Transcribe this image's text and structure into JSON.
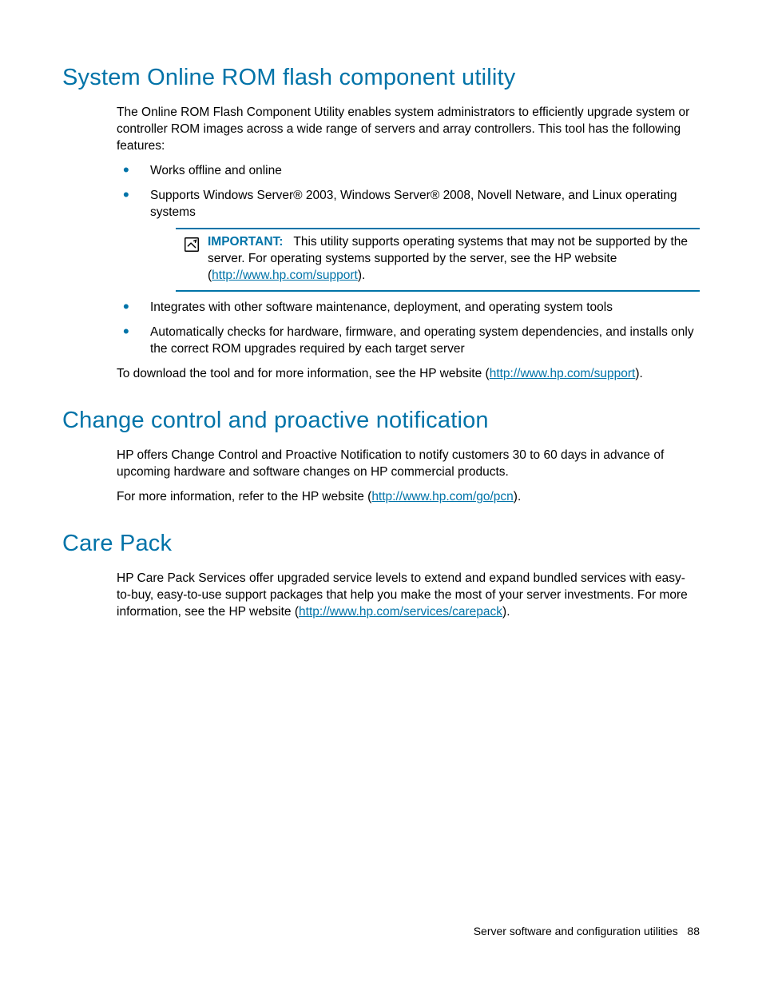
{
  "section1": {
    "heading": "System Online ROM flash component utility",
    "intro": "The Online ROM Flash Component Utility enables system administrators to efficiently upgrade system or controller ROM images across a wide range of servers and array controllers. This tool has the following features:",
    "bullets_pre": [
      "Works offline and online",
      "Supports Windows Server® 2003, Windows Server® 2008, Novell Netware, and Linux operating systems"
    ],
    "callout": {
      "label": "IMPORTANT:",
      "text_before": "This utility supports operating systems that may not be supported by the server. For operating systems supported by the server, see the HP website (",
      "link": "http://www.hp.com/support",
      "text_after": ")."
    },
    "bullets_post": [
      "Integrates with other software maintenance, deployment, and operating system tools",
      "Automatically checks for hardware, firmware, and operating system dependencies, and installs only the correct ROM upgrades required by each target server"
    ],
    "outro_before": "To download the tool and for more information, see the HP website (",
    "outro_link": "http://www.hp.com/support",
    "outro_after": ")."
  },
  "section2": {
    "heading": "Change control and proactive notification",
    "p1": "HP offers Change Control and Proactive Notification to notify customers 30 to 60 days in advance of upcoming hardware and software changes on HP commercial products.",
    "p2_before": "For more information, refer to the HP website (",
    "p2_link": "http://www.hp.com/go/pcn",
    "p2_after": ")."
  },
  "section3": {
    "heading": "Care Pack",
    "p1_before": "HP Care Pack Services offer upgraded service levels to extend and expand bundled services with easy-to-buy, easy-to-use support packages that help you make the most of your server investments. For more information, see the HP website (",
    "p1_link": "http://www.hp.com/services/carepack",
    "p1_after": ")."
  },
  "footer": {
    "text": "Server software and configuration utilities",
    "page": "88"
  }
}
